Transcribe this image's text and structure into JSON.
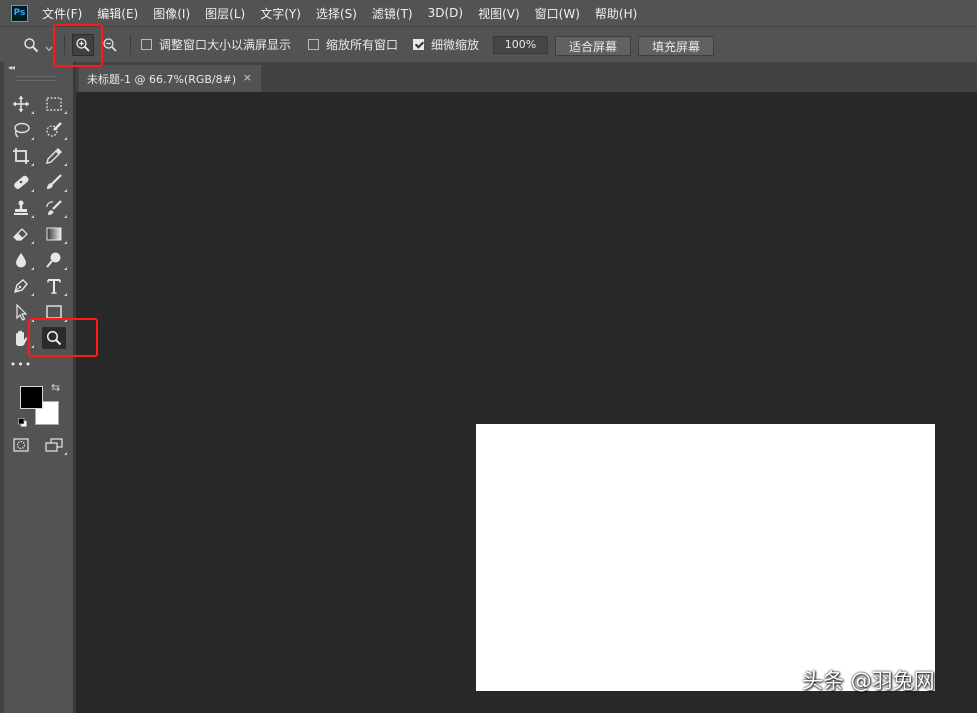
{
  "app": {
    "logo_text": "Ps"
  },
  "menubar": {
    "items": [
      "文件(F)",
      "编辑(E)",
      "图像(I)",
      "图层(L)",
      "文字(Y)",
      "选择(S)",
      "滤镜(T)",
      "3D(D)",
      "视图(V)",
      "窗口(W)",
      "帮助(H)"
    ]
  },
  "options": {
    "resize_windows_label": "调整窗口大小以满屏显示",
    "resize_windows_checked": false,
    "zoom_all_label": "缩放所有窗口",
    "zoom_all_checked": false,
    "scrubby_zoom_label": "细微缩放",
    "scrubby_zoom_checked": true,
    "zoom_percent": "100%",
    "fit_screen_label": "适合屏幕",
    "fill_screen_label": "填充屏幕"
  },
  "document": {
    "tab_title": "未标题-1 @ 66.7%(RGB/8#)",
    "close_glyph": "×"
  },
  "toolbar": {
    "collapse_glyph": "◂◂",
    "more_glyph": "•••"
  },
  "colors": {
    "foreground": "#000000",
    "background": "#ffffff",
    "highlight": "#ff1a1a"
  },
  "watermark": "头条 @羽兔网"
}
